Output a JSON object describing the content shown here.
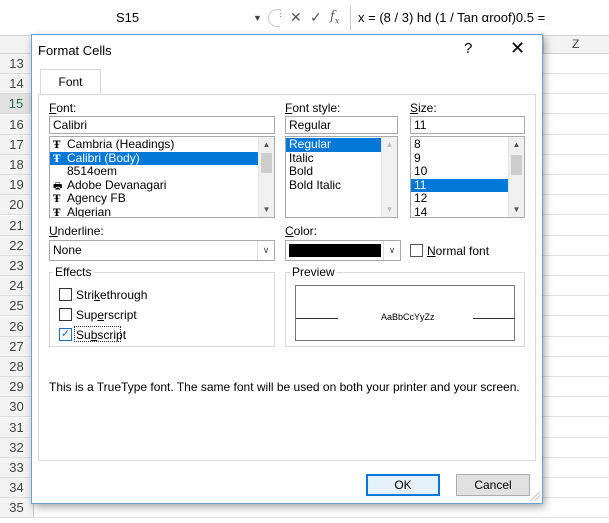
{
  "formula_bar": {
    "name_box": "S15",
    "formula": "x = (8 / 3) hd (1 / Tan αroof)0.5 ="
  },
  "sheet": {
    "column_z": "Z",
    "rows": [
      "13",
      "14",
      "15",
      "16",
      "17",
      "18",
      "19",
      "20",
      "21",
      "22",
      "23",
      "24",
      "25",
      "26",
      "27",
      "28",
      "29",
      "30",
      "31",
      "32",
      "33",
      "34",
      "35"
    ],
    "active_row": "15"
  },
  "dialog": {
    "title": "Format Cells",
    "help": "?",
    "close": "✕",
    "tab_font": "Font",
    "font_label": "Font:",
    "font_value": "Calibri",
    "font_list": [
      {
        "name": "Cambria (Headings)",
        "icon": "truetype-icon"
      },
      {
        "name": "Calibri (Body)",
        "icon": "truetype-icon",
        "selected": true
      },
      {
        "name": "8514oem",
        "icon": ""
      },
      {
        "name": "Adobe Devanagari",
        "icon": "printer-font-icon"
      },
      {
        "name": "Agency FB",
        "icon": "truetype-icon"
      },
      {
        "name": "Algerian",
        "icon": "truetype-icon"
      }
    ],
    "style_label": "Font style:",
    "style_value": "Regular",
    "style_list": [
      "Regular",
      "Italic",
      "Bold",
      "Bold Italic"
    ],
    "size_label": "Size:",
    "size_value": "11",
    "size_list": [
      "8",
      "9",
      "10",
      "11",
      "12",
      "14"
    ],
    "underline_label": "Underline:",
    "underline_value": "None",
    "color_label": "Color:",
    "color_value": "#000000",
    "normal_font_label": "Normal font",
    "effects_label": "Effects",
    "strikethrough_label": "Strikethrough",
    "superscript_label": "Superscript",
    "subscript_label": "Subscript",
    "subscript_checked": true,
    "preview_label": "Preview",
    "preview_text": "AaBbCcYyZz",
    "info_text": "This is a TrueType font.  The same font will be used on both your printer and your screen.",
    "ok_label": "OK",
    "cancel_label": "Cancel"
  }
}
